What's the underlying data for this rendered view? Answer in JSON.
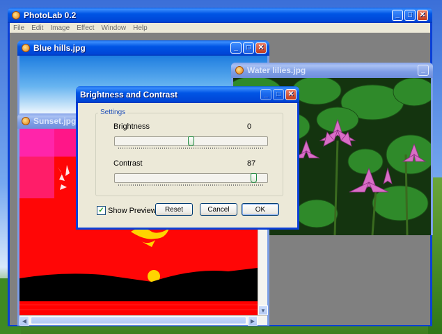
{
  "app": {
    "title": "PhotoLab 0.2"
  },
  "menu": [
    "File",
    "Edit",
    "Image",
    "Effect",
    "Window",
    "Help"
  ],
  "windows": {
    "blue_hills": {
      "title": "Blue hills.jpg"
    },
    "water_lilies": {
      "title": "Water lilies.jpg"
    },
    "sunset": {
      "title": "Sunset.jpg"
    }
  },
  "dialog": {
    "title": "Brightness and Contrast",
    "group_label": "Settings",
    "brightness": {
      "label": "Brightness",
      "value": "0",
      "slider_fraction": 0.5
    },
    "contrast": {
      "label": "Contrast",
      "value": "87",
      "slider_fraction": 0.93
    },
    "show_preview": {
      "label": "Show Preview",
      "checked": true
    },
    "buttons": {
      "reset": "Reset",
      "cancel": "Cancel",
      "ok": "OK"
    }
  },
  "icons": [
    "app-icon",
    "minimize-icon",
    "maximize-icon",
    "close-icon",
    "scroll-arrow-icon",
    "checkmark-icon"
  ]
}
